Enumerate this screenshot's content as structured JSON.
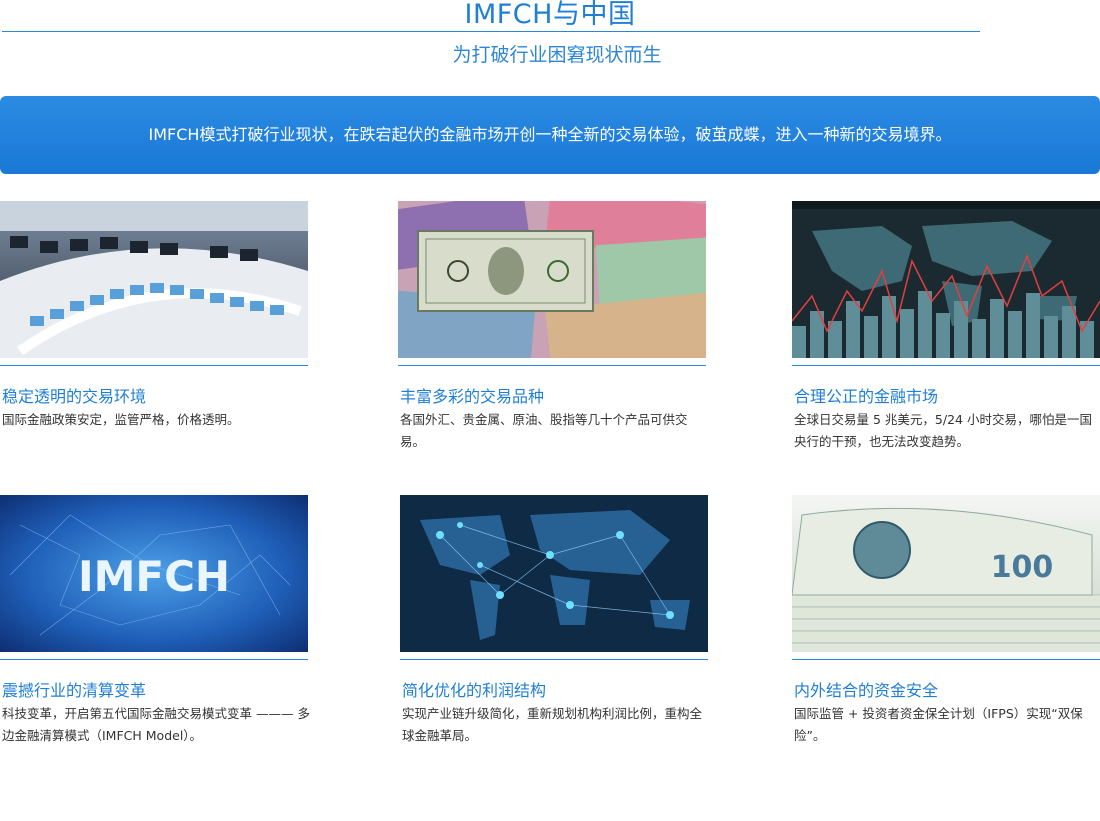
{
  "header": {
    "title": "IMFCH与中国",
    "subtitle": "为打破行业困窘现状而生"
  },
  "banner": {
    "text": "IMFCH模式打破行业现状，在跌宕起伏的金融市场开创一种全新的交易体验，破茧成蝶，进入一种新的交易境界。"
  },
  "cards": [
    {
      "image": "trading-floor-photo",
      "title": "稳定透明的交易环境",
      "desc": "国际金融政策安定，监管严格，价格透明。"
    },
    {
      "image": "banknotes-photo",
      "title": "丰富多彩的交易品种",
      "desc": "各国外汇、贵金属、原油、股指等几十个产品可供交易。"
    },
    {
      "image": "market-chart-photo",
      "title": "合理公正的金融市场",
      "desc": "全球日交易量 5 兆美元，5/24 小时交易，哪怕是一国央行的干预，也无法改变趋势。"
    },
    {
      "image": "imfch-logo-photo",
      "image_text": "IMFCH",
      "title": "震撼行业的清算变革",
      "desc": "科技变革，开启第五代国际金融交易模式变革 ——— 多边金融清算模式（IMFCH Model）。"
    },
    {
      "image": "world-network-photo",
      "title": "简化优化的利润结构",
      "desc": "实现产业链升级简化，重新规划机构利润比例，重构全球金融革局。"
    },
    {
      "image": "dollar-stack-photo",
      "image_text": "100",
      "title": "内外结合的资金安全",
      "desc": "国际监管 + 投资者资金保全计划（IFPS）实现“双保险”。"
    }
  ],
  "colors": {
    "accent": "#1f7fd6",
    "banner": "#1a78d6"
  }
}
